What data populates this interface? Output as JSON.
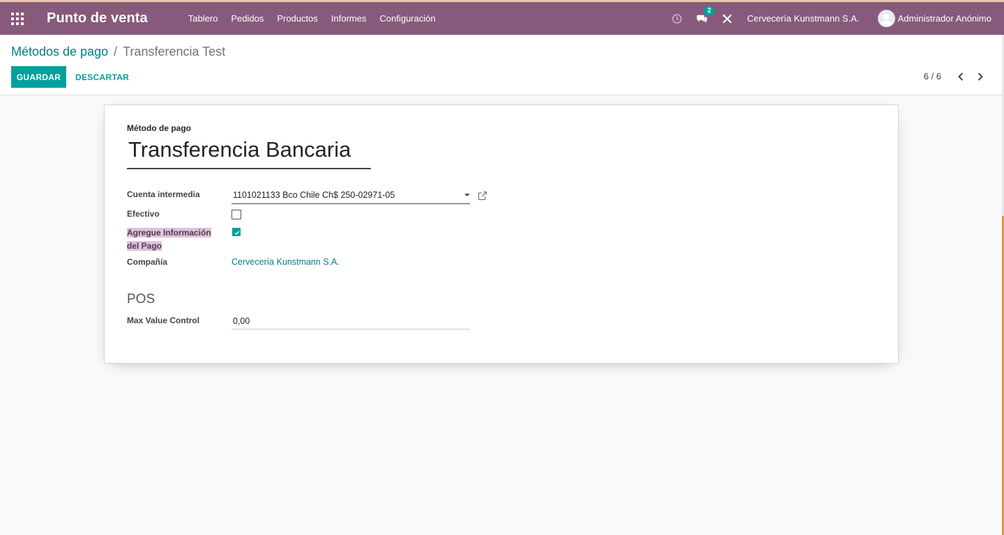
{
  "nav": {
    "app_title": "Punto de venta",
    "menu": [
      "Tablero",
      "Pedidos",
      "Productos",
      "Informes",
      "Configuración"
    ],
    "messages_badge": "2",
    "company": "Cervecería Kunstmann S.A.",
    "user": "Administrador Anónimo",
    "colors": {
      "bar": "#875a7b",
      "accent": "#00a09d"
    },
    "icons": [
      "apps-grid-icon",
      "clock-icon",
      "chat-icon",
      "tools-icon",
      "avatar"
    ]
  },
  "breadcrumb": {
    "parent": "Métodos de pago",
    "separator": "/",
    "current": "Transferencia Test"
  },
  "actions": {
    "save": "GUARDAR",
    "discard": "DESCARTAR"
  },
  "pager": {
    "text": "6 / 6"
  },
  "form": {
    "name_label": "Método de pago",
    "name_value": "Transferencia Bancaria",
    "fields": {
      "intermediate_account_label": "Cuenta intermedia",
      "intermediate_account_value": "1101021133 Bco Chile Ch$ 250-02971-05",
      "cash_label": "Efectivo",
      "cash_checked": false,
      "payment_info_label_line1": "Agregue Información",
      "payment_info_label_line2": "del Pago",
      "payment_info_checked": true,
      "company_label": "Compañía",
      "company_value": "Cervecería Kunstmann S.A."
    },
    "pos_section": {
      "title": "POS",
      "max_value_label": "Max Value Control",
      "max_value": "0,00"
    }
  }
}
